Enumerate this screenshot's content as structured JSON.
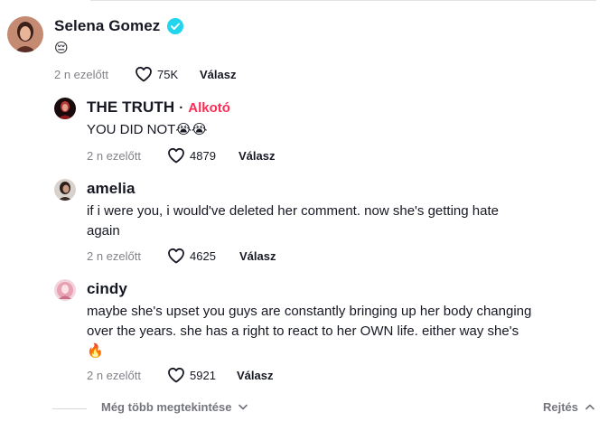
{
  "comments": [
    {
      "username": "Selena Gomez",
      "verified": true,
      "text": "😔",
      "timestamp": "2 n ezelőtt",
      "likes": "75K",
      "reply_label": "Válasz"
    },
    {
      "username": "THE TRUTH",
      "separator": "·",
      "creator_tag": "Alkotó",
      "text": "YOU DID NOT😭😭",
      "timestamp": "2 n ezelőtt",
      "likes": "4879",
      "reply_label": "Válasz"
    },
    {
      "username": "amelia",
      "text_line1": "if i were you, i would've deleted her comment. now she's getting hate",
      "text_line2": "again",
      "timestamp": "2 n ezelőtt",
      "likes": "4625",
      "reply_label": "Válasz"
    },
    {
      "username": "cindy",
      "text_line1": "maybe she's upset you guys are constantly bringing up her body changing",
      "text_line2": "over the years. she has a right to react to her OWN life. either way she's",
      "text_line3": "🔥",
      "timestamp": "2 n ezelőtt",
      "likes": "5921",
      "reply_label": "Válasz"
    }
  ],
  "footer": {
    "view_more_label": "Még több megtekintése",
    "hide_label": "Rejtés"
  },
  "colors": {
    "creator_accent": "#fe2c55",
    "verified_badge": "#20d5ec",
    "text_primary": "#161823"
  }
}
